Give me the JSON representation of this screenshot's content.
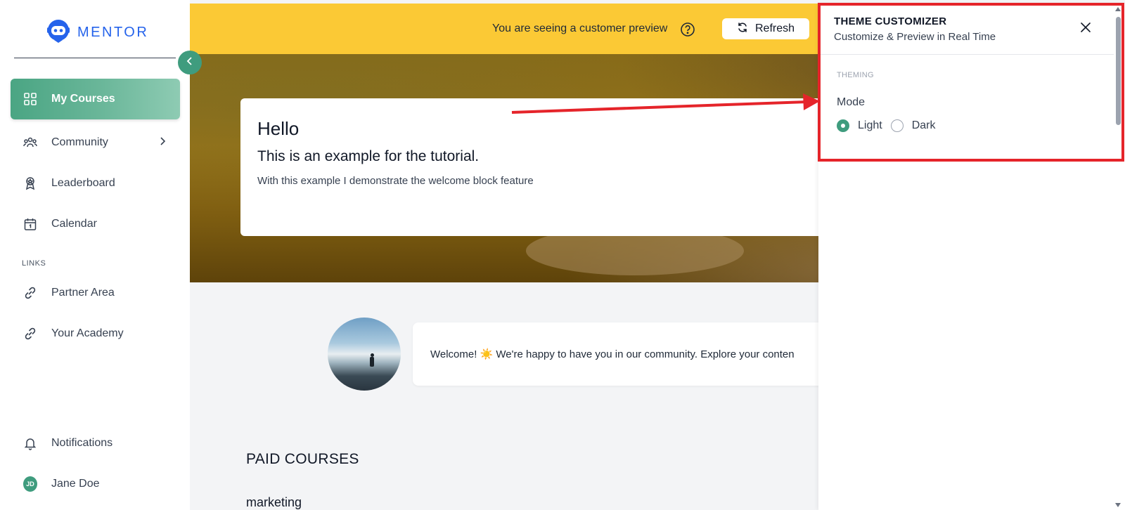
{
  "brand": {
    "name": "MENTOR",
    "logo_icon": "robot-icon",
    "accent": "#3f9c7e",
    "logo_color": "#2563eb"
  },
  "sidebar": {
    "items": [
      {
        "label": "My Courses",
        "icon": "grid-icon",
        "active": true
      },
      {
        "label": "Community",
        "icon": "people-icon",
        "has_submenu": true
      },
      {
        "label": "Leaderboard",
        "icon": "award-icon"
      },
      {
        "label": "Calendar",
        "icon": "calendar-icon"
      }
    ],
    "links_label": "LINKS",
    "links": [
      {
        "label": "Partner Area",
        "icon": "link-icon"
      },
      {
        "label": "Your Academy",
        "icon": "link-icon"
      }
    ],
    "bottom": [
      {
        "label": "Notifications",
        "icon": "bell-icon"
      },
      {
        "label": "Jane Doe",
        "initials": "JD"
      }
    ]
  },
  "preview_bar": {
    "text": "You are seeing a customer preview",
    "refresh_label": "Refresh",
    "color": "#fbc935"
  },
  "hero": {
    "title": "Hello",
    "subtitle": "This is an example for the tutorial.",
    "description": "With this example I demonstrate the welcome block feature"
  },
  "welcome": {
    "text": "Welcome! ☀️ We're happy to have you in our community. Explore your conten"
  },
  "courses": {
    "section_title": "PAID COURSES",
    "category": "marketing"
  },
  "customizer": {
    "title": "THEME CUSTOMIZER",
    "subtitle": "Customize & Preview in Real Time",
    "section_label": "THEMING",
    "mode_label": "Mode",
    "options": [
      {
        "label": "Light",
        "checked": true
      },
      {
        "label": "Dark",
        "checked": false
      }
    ]
  },
  "annotation": {
    "color": "#e5242a"
  }
}
